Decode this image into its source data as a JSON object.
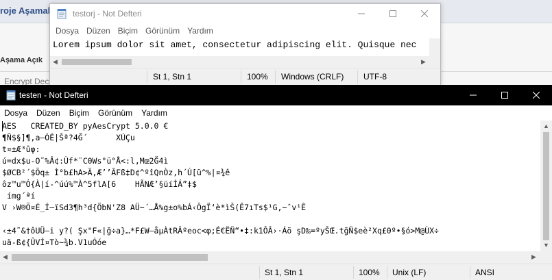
{
  "background_app": {
    "title": "roje Aşamal",
    "step_label": "Aşama Açık",
    "encrypt_label": "Encrypt Dec"
  },
  "window_back": {
    "title": "testorj - Not Defteri",
    "menu": [
      "Dosya",
      "Düzen",
      "Biçim",
      "Görünüm",
      "Yardım"
    ],
    "content": "Lorem ipsum dolor sit amet, consectetur adipiscing elit. Quisque nec",
    "status": {
      "position": "St 1, Stn 1",
      "zoom": "100%",
      "line_ending": "Windows (CRLF)",
      "encoding": "UTF-8"
    }
  },
  "window_front": {
    "title": "testen - Not Defteri",
    "menu": [
      "Dosya",
      "Düzen",
      "Biçim",
      "Görünüm",
      "Yardım"
    ],
    "lines": [
      "AES   CREATED_BY pyAesCrypt 5.0.0 €",
      "¶Ñ$§]¶,a–ÓÉ|Šª?4Ğ´      XÚÇu",
      "t¤±Æ³ûφ:",
      "ú=dx$u-O˜%Â¢:Ùf*¨C0Ws°ü°Å<:l,Mœ2Ğ4ì",
      "$ØCB²´$Õq± Ì°b£hA>Ä,Æ’’ÃFß‡D¢^ºîQnÒz,h´Ú[ü^%|¤¾ê",
      "ôz™u™Ó{À|í-^úú%™À^5flA[6    HÃNÆ’§üíÍÁ”‡$",
      " ímg´ªí",
      "V ›W®Õ¤É_Í–ïSd3¶h³d{ÖbN'Z8 AÜ~´…Å%g±o%bÁ‹ÔgÏ‘è*ìŠ(Ê7ıTs$¹G,~ˆv¹Ê",
      "",
      "‹±4˜&†ôUÜ–i y?( Şx\"F«|ğ÷a}…*F£W–åµÀtRÂºeoc<φ;É€ËÑ“•‡:k1ÔÂ›·Áö şD‰=ºyŠŒ.tğÑ$eè²Xq£0º•§ó>M@ÙX÷",
      "uä-ß¢{ÛVÍ¤Tò~¾b.V1uÓóe"
    ],
    "status": {
      "position": "St 1, Stn 1",
      "zoom": "100%",
      "line_ending": "Unix (LF)",
      "encoding": "ANSI"
    }
  }
}
